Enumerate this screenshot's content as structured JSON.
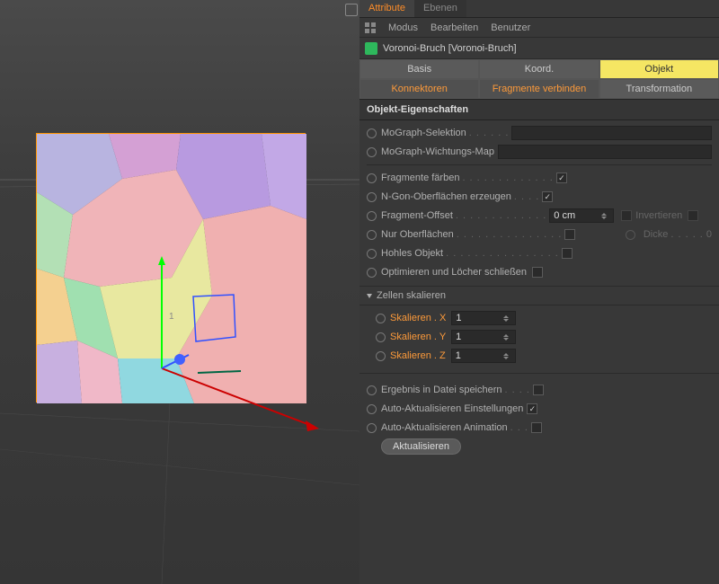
{
  "tabs": {
    "attribute": "Attribute",
    "ebenen": "Ebenen"
  },
  "toolbar": {
    "modus": "Modus",
    "bearbeiten": "Bearbeiten",
    "benutzer": "Benutzer"
  },
  "object": {
    "name": "Voronoi-Bruch [Voronoi-Bruch]"
  },
  "bigtabs": {
    "basis": "Basis",
    "koord": "Koord.",
    "objekt": "Objekt",
    "konnektoren": "Konnektoren",
    "fragmente": "Fragmente verbinden",
    "transformation": "Transformation"
  },
  "section": {
    "props": "Objekt-Eigenschaften",
    "zellen": "Zellen skalieren"
  },
  "props": {
    "mograph_sel": "MoGraph-Selektion",
    "mograph_weight": "MoGraph-Wichtungs-Map",
    "fragmente_faerben": "Fragmente färben",
    "ngon": "N-Gon-Oberflächen erzeugen",
    "fragment_offset": "Fragment-Offset",
    "fragment_offset_val": "0 cm",
    "invertieren": "Invertieren",
    "nur_oberflaechen": "Nur Oberflächen",
    "dicke": "Dicke",
    "dicke_val": "0",
    "hohles": "Hohles Objekt",
    "optimieren": "Optimieren und Löcher schließen",
    "skalieren_x": "Skalieren . X",
    "skalieren_y": "Skalieren . Y",
    "skalieren_z": "Skalieren . Z",
    "sx": "1",
    "sy": "1",
    "sz": "1",
    "ergebnis": "Ergebnis in Datei speichern",
    "auto_einst": "Auto-Aktualisieren Einstellungen",
    "auto_anim": "Auto-Aktualisieren Animation",
    "aktualisieren": "Aktualisieren"
  }
}
